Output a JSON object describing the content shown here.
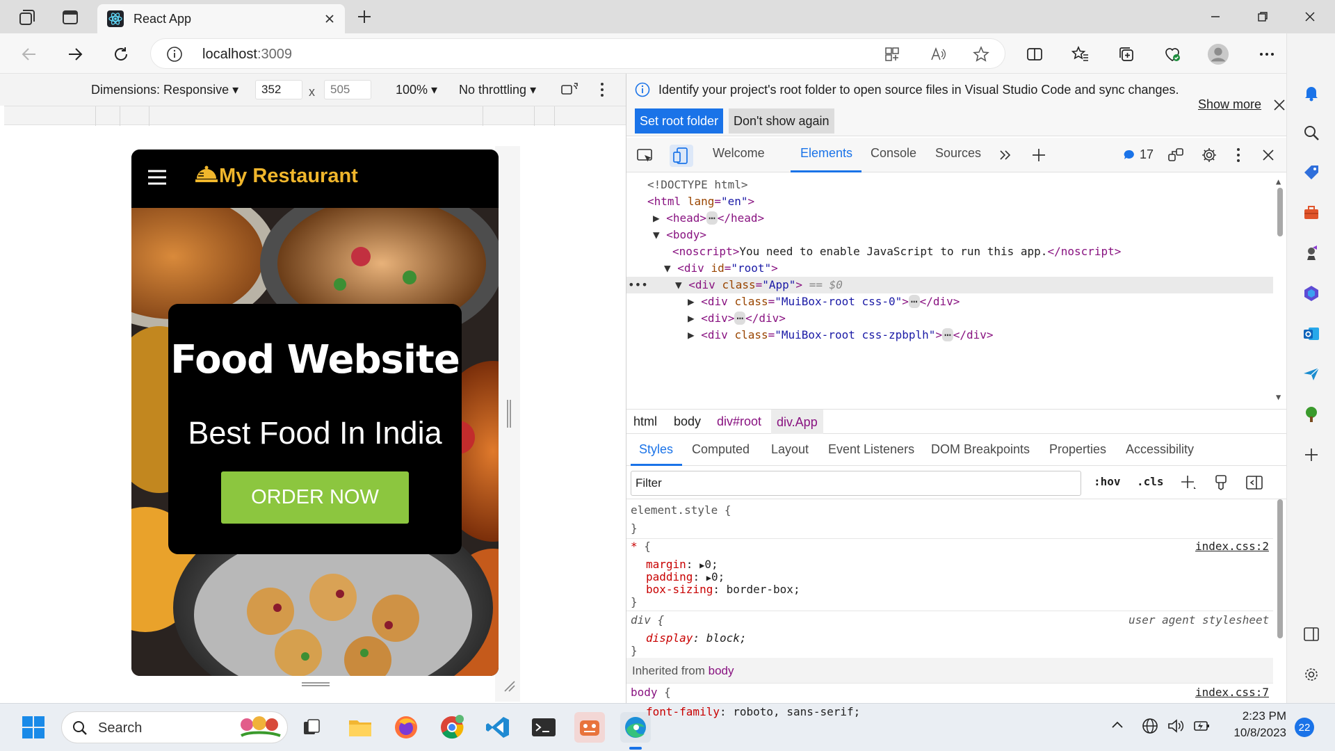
{
  "browser": {
    "tab_title": "React App",
    "url_host": "localhost",
    "url_port": ":3009"
  },
  "device_toolbar": {
    "dimensions_label": "Dimensions: Responsive",
    "width": "352",
    "height": "505",
    "times": "x",
    "zoom": "100%",
    "throttling": "No throttling"
  },
  "page": {
    "brand": "My Restaurant",
    "headline": "Food Website",
    "subheadline": "Best Food In India",
    "cta": "ORDER NOW"
  },
  "devtools": {
    "info_message": "Identify your project's root folder to open source files in Visual Studio Code and sync changes.",
    "show_more": "Show more",
    "set_root_folder": "Set root folder",
    "dont_show_again": "Don't show again",
    "tabs": [
      "Welcome",
      "Elements",
      "Console",
      "Sources"
    ],
    "issues_count": "17",
    "dom": {
      "l1": "<!DOCTYPE html>",
      "html_open": "<html",
      "html_attr": "lang",
      "html_val": "\"en\"",
      "head_open": "<head>",
      "head_close": "</head>",
      "body_open": "<body>",
      "noscript_open": "<noscript>",
      "noscript_text": "You need to enable JavaScript to run this app.",
      "noscript_close": "</noscript>",
      "div_open": "<div",
      "id_attr": "id",
      "root_val": "\"root\"",
      "class_attr": "class",
      "app_val": "\"App\"",
      "eq0": "== $0",
      "muibox_val": "\"MuiBox-root css-0\"",
      "div_close": "</div>",
      "div_plain": "<div>",
      "muibox2_val": "\"MuiBox-root css-zpbplh\""
    },
    "breadcrumbs": [
      "html",
      "body",
      "div#root",
      "div.App"
    ],
    "style_tabs": [
      "Styles",
      "Computed",
      "Layout",
      "Event Listeners",
      "DOM Breakpoints",
      "Properties",
      "Accessibility"
    ],
    "filter_placeholder": "Filter",
    "hov": ":hov",
    "cls": ".cls",
    "styles": {
      "element_style": "element.style {",
      "close_brace": "}",
      "star_selector": "*",
      "open_brace": "{",
      "src1": "index.css:2",
      "margin_prop": "margin",
      "margin_val": "0;",
      "padding_prop": "padding",
      "padding_val": "0;",
      "boxsizing_prop": "box-sizing",
      "boxsizing_val": "border-box;",
      "div_selector": "div {",
      "ua_label": "user agent stylesheet",
      "display_prop": "display",
      "display_val": "block;",
      "inherited_label": "Inherited from",
      "inherited_from": "body",
      "body_selector": "body",
      "src2": "index.css:7",
      "fontfamily_prop": "font-family",
      "fontfamily_val": "roboto, sans-serif;",
      "colon": ":"
    }
  },
  "taskbar": {
    "search_label": "Search",
    "time": "2:23 PM",
    "date": "10/8/2023",
    "notifications": "22"
  }
}
